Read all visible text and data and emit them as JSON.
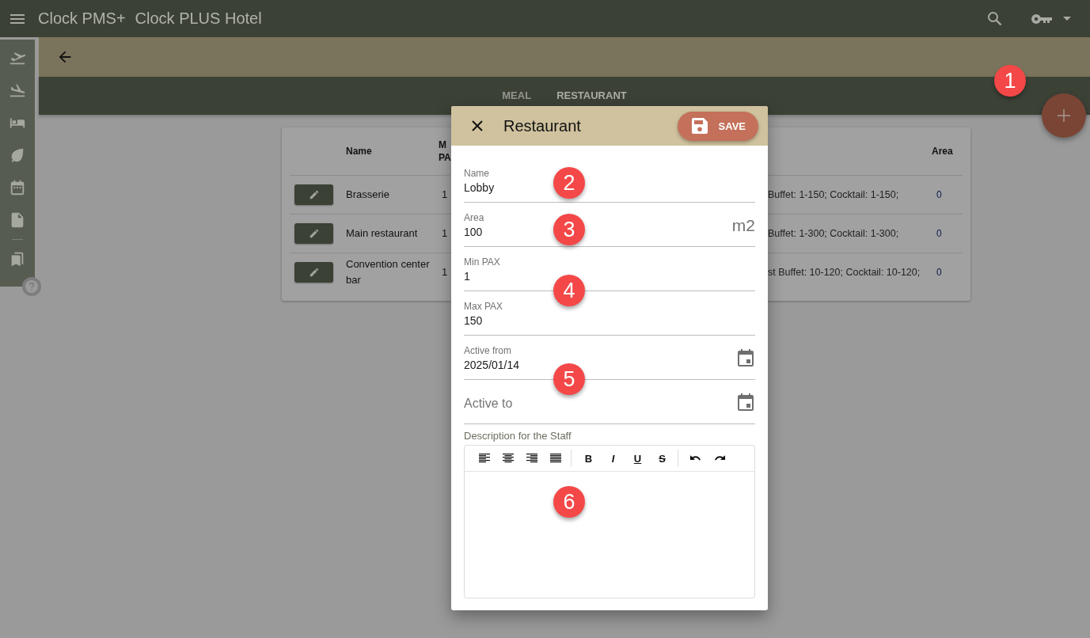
{
  "app_bar": {
    "title": "Clock PMS+",
    "hotel": "Clock PLUS Hotel"
  },
  "tabs": [
    {
      "label": "MEAL",
      "selected": false
    },
    {
      "label": "RESTAURANT",
      "selected": true
    }
  ],
  "table": {
    "columns": {
      "name": "Name",
      "column_2": "M PA",
      "area": "Area"
    },
    "rows": [
      {
        "name": "Brasserie",
        "column_2": "1",
        "column_4": "Buffet: 1-150; Cocktail: 1-150;",
        "area": "0"
      },
      {
        "name": "Main restaurant",
        "column_2": "1",
        "column_4": "Buffet: 1-300; Cocktail: 1-300;",
        "area": "0"
      },
      {
        "name": "Convention center bar",
        "column_2": "1",
        "column_4": "st Buffet: 10-120; Cocktail: 10-120;",
        "area": "0"
      }
    ]
  },
  "dialog": {
    "title": "Restaurant",
    "save_label": "SAVE",
    "fields": [
      {
        "kind": "text",
        "label": "Name",
        "value": "Lobby"
      },
      {
        "kind": "text",
        "label": "Area",
        "value": "100",
        "suffix": "m2"
      },
      {
        "kind": "text",
        "label": "Min PAX",
        "value": "1"
      },
      {
        "kind": "text",
        "label": "Max PAX",
        "value": "150"
      },
      {
        "kind": "date",
        "label": "Active from",
        "value": "2025/01/14"
      },
      {
        "kind": "date",
        "label": "Active to"
      }
    ],
    "description": {
      "label": "Description for the Staff",
      "toolbar": [
        {
          "kind": "align-left"
        },
        {
          "kind": "align-center"
        },
        {
          "kind": "align-right"
        },
        {
          "kind": "justify"
        },
        {
          "kind": "divider"
        },
        {
          "kind": "bold",
          "label": "B"
        },
        {
          "kind": "italic",
          "label": "I"
        },
        {
          "kind": "underline",
          "label": "U"
        },
        {
          "kind": "strike",
          "label": "S"
        },
        {
          "kind": "divider"
        },
        {
          "kind": "undo"
        },
        {
          "kind": "redo"
        }
      ]
    }
  },
  "callouts": [
    "1",
    "2",
    "3",
    "4",
    "5",
    "6"
  ]
}
